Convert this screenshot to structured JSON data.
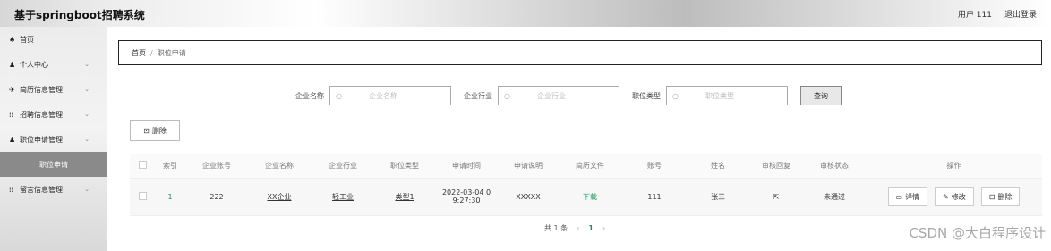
{
  "header": {
    "title": "基于springboot招聘系统",
    "user": "用户 111",
    "logout": "退出登录"
  },
  "sidebar": {
    "items": [
      {
        "icon": "home-icon",
        "glyph": "♠",
        "label": "首页",
        "chevron": ""
      },
      {
        "icon": "user-icon",
        "glyph": "♟",
        "label": "个人中心",
        "chevron": "⌄"
      },
      {
        "icon": "send-icon",
        "glyph": "✈",
        "label": "简历信息管理",
        "chevron": "⌄"
      },
      {
        "icon": "grid-icon",
        "glyph": "⁞⁞",
        "label": "招聘信息管理",
        "chevron": "⌄"
      },
      {
        "icon": "user-icon",
        "glyph": "♟",
        "label": "职位申请管理",
        "chevron": "⌄"
      },
      {
        "icon": "",
        "glyph": "",
        "label": "职位申请",
        "chevron": ""
      },
      {
        "icon": "grid-icon",
        "glyph": "⁞⁞",
        "label": "留言信息管理",
        "chevron": "⌄"
      }
    ]
  },
  "breadcrumb": {
    "home": "首页",
    "separator": "/",
    "current": "职位申请"
  },
  "search": {
    "fields": [
      {
        "label": "企业名称",
        "placeholder": "企业名称"
      },
      {
        "label": "企业行业",
        "placeholder": "企业行业"
      },
      {
        "label": "职位类型",
        "placeholder": "职位类型"
      }
    ],
    "query_label": "查询"
  },
  "toolbar": {
    "delete_label": "删除"
  },
  "table": {
    "headers": [
      "",
      "索引",
      "企业账号",
      "企业名称",
      "企业行业",
      "职位类型",
      "申请时间",
      "申请说明",
      "简历文件",
      "账号",
      "姓名",
      "审核回复",
      "审核状态",
      "操作"
    ],
    "rows": [
      {
        "index": "1",
        "company_account": "222",
        "company_name": "XX企业",
        "industry": "轻工业",
        "job_type": "类型1",
        "apply_time_date": "2022-03-04 0",
        "apply_time_clock": "9:27:30",
        "apply_note": "XXXXX",
        "resume": "下载",
        "account": "111",
        "name": "张三",
        "review_reply": "",
        "review_status": "未通过",
        "ops": {
          "detail": "详情",
          "edit": "修改",
          "delete": "删除"
        }
      }
    ]
  },
  "pagination": {
    "total": "共 1 条",
    "prev": "‹",
    "page": "1",
    "next": "›"
  },
  "watermark": "CSDN @大白程序设计",
  "colors": {
    "accent_green": "#2a8a6a",
    "active_sidebar": "#8a8a8a"
  }
}
